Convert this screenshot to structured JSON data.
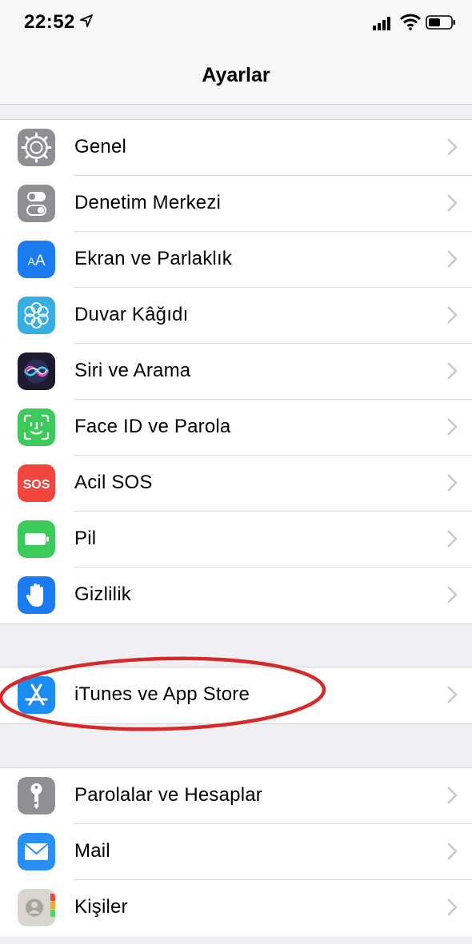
{
  "status_bar": {
    "time": "22:52",
    "icons": [
      "location-arrow-icon",
      "cellular-signal-icon",
      "wifi-icon",
      "battery-icon"
    ]
  },
  "nav": {
    "title": "Ayarlar"
  },
  "groups": [
    {
      "items": [
        {
          "label": "Genel",
          "icon": "gear-icon",
          "color": "#8e8e93"
        },
        {
          "label": "Denetim Merkezi",
          "icon": "toggles-icon",
          "color": "#8e8e93"
        },
        {
          "label": "Ekran ve Parlaklık",
          "icon": "text-size-icon",
          "color": "#1b7cf2"
        },
        {
          "label": "Duvar Kâğıdı",
          "icon": "flower-icon",
          "color": "#37aee2"
        },
        {
          "label": "Siri ve Arama",
          "icon": "siri-icon",
          "color": "#1c1c2e"
        },
        {
          "label": "Face ID ve Parola",
          "icon": "face-id-icon",
          "color": "#3ccb5b"
        },
        {
          "label": "Acil SOS",
          "icon": "sos-icon",
          "color": "#f2453d",
          "icon_text": "SOS"
        },
        {
          "label": "Pil",
          "icon": "battery-app-icon",
          "color": "#3ccb5b"
        },
        {
          "label": "Gizlilik",
          "icon": "hand-icon",
          "color": "#1b7cf2"
        }
      ]
    },
    {
      "items": [
        {
          "label": "iTunes ve App Store",
          "icon": "app-store-icon",
          "color": "#1b8cf2"
        }
      ]
    },
    {
      "items": [
        {
          "label": "Parolalar ve Hesaplar",
          "icon": "key-icon",
          "color": "#8e8e93"
        },
        {
          "label": "Mail",
          "icon": "mail-icon",
          "color": "#2a8ff5"
        },
        {
          "label": "Kişiler",
          "icon": "contacts-icon",
          "color": "#d9d6cf"
        }
      ]
    }
  ],
  "annotation": {
    "color": "#d42a2a",
    "target": "iTunes ve App Store"
  },
  "colors": {
    "background": "#efeff4",
    "chevron": "#c7c7cc",
    "separator": "#dcdce0"
  }
}
